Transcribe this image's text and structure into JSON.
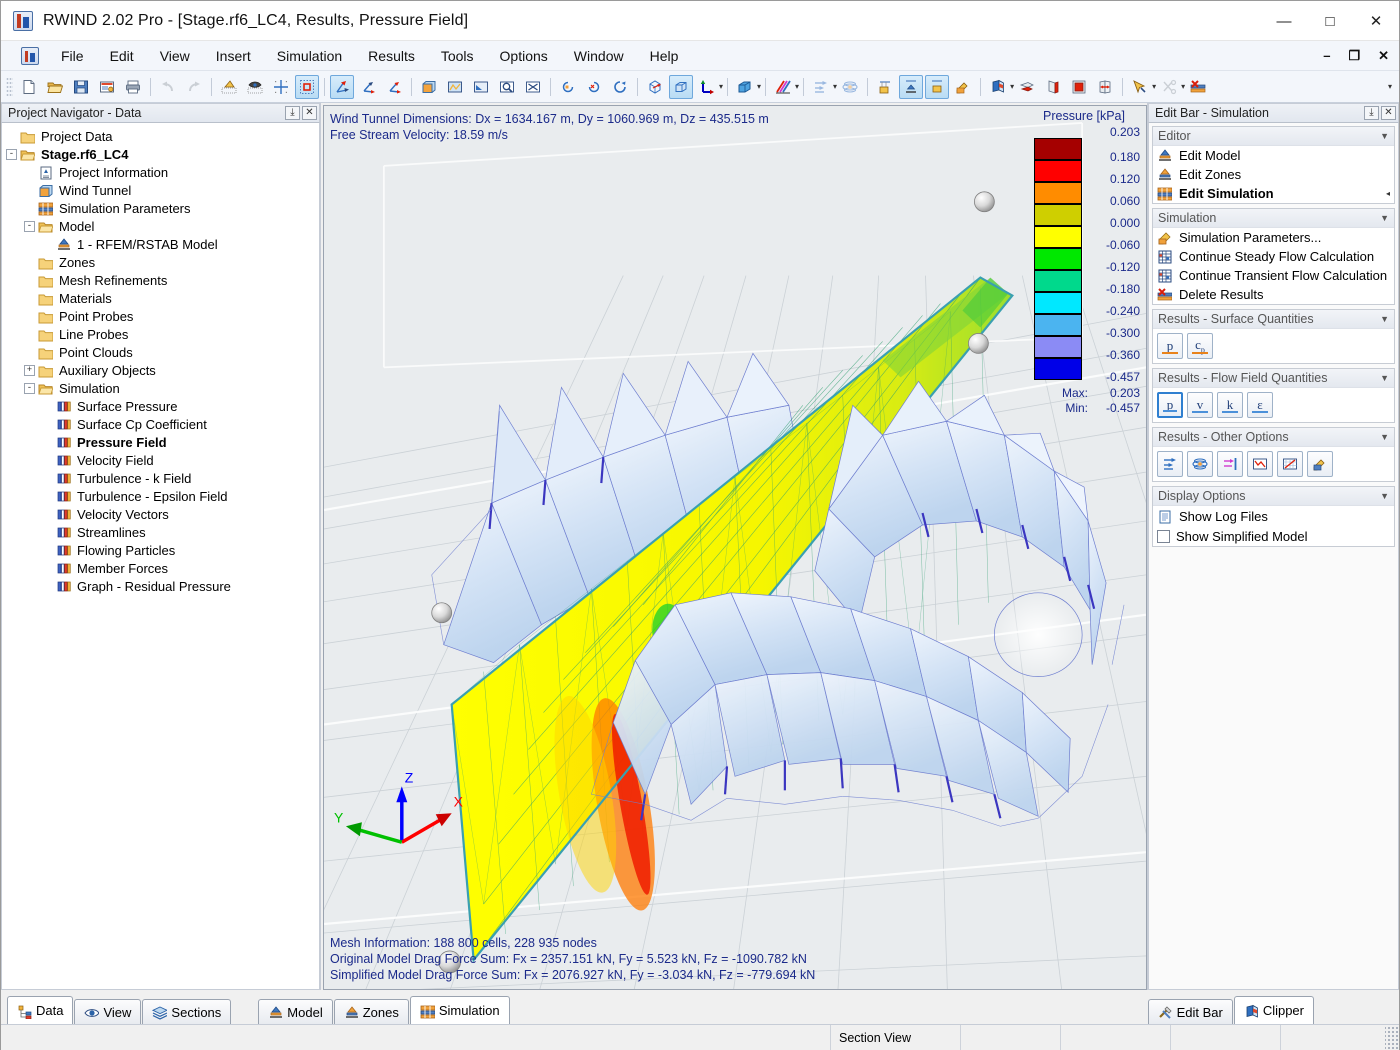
{
  "window": {
    "title": "RWIND 2.02 Pro - [Stage.rf6_LC4, Results, Pressure Field]",
    "minimize": "—",
    "maximize": "□",
    "close": "✕"
  },
  "mdi": {
    "minimize": "–",
    "restore": "❐",
    "close": "✕"
  },
  "menubar": {
    "items": [
      {
        "label": "File"
      },
      {
        "label": "Edit"
      },
      {
        "label": "View"
      },
      {
        "label": "Insert"
      },
      {
        "label": "Simulation"
      },
      {
        "label": "Results"
      },
      {
        "label": "Tools"
      },
      {
        "label": "Options"
      },
      {
        "label": "Window"
      },
      {
        "label": "Help"
      }
    ]
  },
  "toolbar": {
    "groups": [
      {
        "buttons": [
          {
            "icon": "new-document-icon",
            "state": "normal"
          },
          {
            "icon": "open-folder-icon",
            "state": "normal"
          },
          {
            "icon": "save-disk-icon",
            "state": "normal"
          },
          {
            "icon": "project-info-icon",
            "state": "normal"
          },
          {
            "icon": "print-icon",
            "state": "normal"
          }
        ]
      },
      {
        "buttons": [
          {
            "icon": "undo-icon",
            "state": "disabled"
          },
          {
            "icon": "redo-icon",
            "state": "disabled"
          }
        ]
      },
      {
        "buttons": [
          {
            "icon": "snap-points-icon",
            "state": "normal"
          },
          {
            "icon": "object-snap-icon",
            "state": "normal"
          },
          {
            "icon": "grid-snap-icon",
            "state": "normal"
          },
          {
            "icon": "selection-frame-icon",
            "state": "active"
          }
        ]
      },
      {
        "buttons": [
          {
            "icon": "move-axes-icon",
            "state": "active"
          },
          {
            "icon": "rotate-axes-icon",
            "state": "normal"
          },
          {
            "icon": "scale-axes-icon",
            "state": "normal"
          }
        ]
      },
      {
        "buttons": [
          {
            "icon": "wind-tunnel-icon",
            "state": "normal"
          },
          {
            "icon": "mesh-surface-icon",
            "state": "normal"
          },
          {
            "icon": "zoom-window-icon",
            "state": "normal"
          },
          {
            "icon": "zoom-area-icon",
            "state": "normal"
          },
          {
            "icon": "zoom-all-icon",
            "state": "normal"
          }
        ]
      },
      {
        "buttons": [
          {
            "icon": "rotate-left-icon",
            "state": "normal"
          },
          {
            "icon": "rotate-right-icon",
            "state": "normal"
          },
          {
            "icon": "rotate-view-icon",
            "state": "normal"
          }
        ]
      },
      {
        "buttons": [
          {
            "icon": "wireframe-cube-icon",
            "state": "normal"
          },
          {
            "icon": "solid-cube-icon",
            "state": "active"
          },
          {
            "icon": "axes-display-icon",
            "state": "normal",
            "dropdown": true
          }
        ]
      },
      {
        "buttons": [
          {
            "icon": "render-cube-icon",
            "state": "normal",
            "dropdown": true
          }
        ]
      },
      {
        "buttons": [
          {
            "icon": "color-scale-icon",
            "state": "normal",
            "dropdown": true
          }
        ]
      },
      {
        "buttons": [
          {
            "icon": "flow-arrows-icon",
            "state": "disabled",
            "dropdown": true
          },
          {
            "icon": "streamline-icon",
            "state": "disabled"
          }
        ]
      },
      {
        "buttons": [
          {
            "icon": "result-values-icon",
            "state": "normal"
          },
          {
            "icon": "model-results-icon",
            "state": "active"
          },
          {
            "icon": "surface-results-icon",
            "state": "active"
          },
          {
            "icon": "render-results-icon",
            "state": "normal"
          }
        ]
      },
      {
        "buttons": [
          {
            "icon": "clipper-box-icon",
            "state": "normal",
            "dropdown": true
          },
          {
            "icon": "section-plane-x-icon",
            "state": "normal"
          },
          {
            "icon": "section-plane-y-icon",
            "state": "normal"
          },
          {
            "icon": "section-plane-z-icon",
            "state": "normal"
          },
          {
            "icon": "section-move-icon",
            "state": "normal"
          }
        ]
      },
      {
        "buttons": [
          {
            "icon": "select-objects-icon",
            "state": "normal",
            "dropdown": true
          },
          {
            "icon": "cut-tool-icon",
            "state": "disabled",
            "dropdown": true
          },
          {
            "icon": "delete-results-icon",
            "state": "normal"
          }
        ]
      }
    ],
    "overflow": "▾"
  },
  "navigator": {
    "caption": "Project Navigator - Data",
    "pin": "⤓",
    "close": "✕",
    "tree": [
      {
        "label": "Project Data",
        "depth": 0,
        "expander": "",
        "icon": "folder-icon",
        "bold": false
      },
      {
        "label": "Stage.rf6_LC4",
        "depth": 0,
        "expander": "-",
        "icon": "folder-open-icon",
        "bold": true
      },
      {
        "label": "Project Information",
        "depth": 1,
        "expander": "",
        "icon": "document-info-icon",
        "bold": false
      },
      {
        "label": "Wind Tunnel",
        "depth": 1,
        "expander": "",
        "icon": "wind-tunnel-icon",
        "bold": false
      },
      {
        "label": "Simulation Parameters",
        "depth": 1,
        "expander": "",
        "icon": "simulation-params-icon",
        "bold": false
      },
      {
        "label": "Model",
        "depth": 1,
        "expander": "-",
        "icon": "folder-open-icon",
        "bold": false
      },
      {
        "label": "1 - RFEM/RSTAB Model",
        "depth": 2,
        "expander": "",
        "icon": "model-icon",
        "bold": false
      },
      {
        "label": "Zones",
        "depth": 1,
        "expander": "",
        "icon": "folder-icon",
        "bold": false
      },
      {
        "label": "Mesh Refinements",
        "depth": 1,
        "expander": "",
        "icon": "folder-icon",
        "bold": false
      },
      {
        "label": "Materials",
        "depth": 1,
        "expander": "",
        "icon": "folder-icon",
        "bold": false
      },
      {
        "label": "Point Probes",
        "depth": 1,
        "expander": "",
        "icon": "folder-icon",
        "bold": false
      },
      {
        "label": "Line Probes",
        "depth": 1,
        "expander": "",
        "icon": "folder-icon",
        "bold": false
      },
      {
        "label": "Point Clouds",
        "depth": 1,
        "expander": "",
        "icon": "folder-icon",
        "bold": false
      },
      {
        "label": "Auxiliary Objects",
        "depth": 1,
        "expander": "+",
        "icon": "folder-icon",
        "bold": false
      },
      {
        "label": "Simulation",
        "depth": 1,
        "expander": "-",
        "icon": "folder-open-icon",
        "bold": false
      },
      {
        "label": "Surface Pressure",
        "depth": 2,
        "expander": "",
        "icon": "results-bars-icon",
        "bold": false
      },
      {
        "label": "Surface Cp Coefficient",
        "depth": 2,
        "expander": "",
        "icon": "results-bars-icon",
        "bold": false
      },
      {
        "label": "Pressure Field",
        "depth": 2,
        "expander": "",
        "icon": "results-bars-icon",
        "bold": true
      },
      {
        "label": "Velocity Field",
        "depth": 2,
        "expander": "",
        "icon": "results-bars-icon",
        "bold": false
      },
      {
        "label": "Turbulence - k Field",
        "depth": 2,
        "expander": "",
        "icon": "results-bars-icon",
        "bold": false
      },
      {
        "label": "Turbulence - Epsilon Field",
        "depth": 2,
        "expander": "",
        "icon": "results-bars-icon",
        "bold": false
      },
      {
        "label": "Velocity Vectors",
        "depth": 2,
        "expander": "",
        "icon": "results-bars-icon",
        "bold": false
      },
      {
        "label": "Streamlines",
        "depth": 2,
        "expander": "",
        "icon": "results-bars-icon",
        "bold": false
      },
      {
        "label": "Flowing Particles",
        "depth": 2,
        "expander": "",
        "icon": "results-bars-icon",
        "bold": false
      },
      {
        "label": "Member Forces",
        "depth": 2,
        "expander": "",
        "icon": "results-bars-icon",
        "bold": false
      },
      {
        "label": "Graph - Residual Pressure",
        "depth": 2,
        "expander": "",
        "icon": "results-bars-icon",
        "bold": false
      }
    ]
  },
  "editbar": {
    "caption": "Edit Bar - Simulation",
    "pin": "⤓",
    "close": "✕",
    "groups": [
      {
        "title": "Editor",
        "type": "items",
        "items": [
          {
            "label": "Edit Model",
            "icon": "model-icon",
            "bold": false,
            "arrow": ""
          },
          {
            "label": "Edit Zones",
            "icon": "zones-icon",
            "bold": false,
            "arrow": ""
          },
          {
            "label": "Edit Simulation",
            "icon": "simulation-params-icon",
            "bold": true,
            "arrow": "◂"
          }
        ]
      },
      {
        "title": "Simulation",
        "type": "items",
        "items": [
          {
            "label": "Simulation Parameters...",
            "icon": "sim-settings-icon",
            "bold": false,
            "arrow": ""
          },
          {
            "label": "Continue Steady Flow Calculation",
            "icon": "calc-table-icon",
            "bold": false,
            "arrow": ""
          },
          {
            "label": "Continue Transient Flow Calculation",
            "icon": "calc-table-icon",
            "bold": false,
            "arrow": ""
          },
          {
            "label": "Delete Results",
            "icon": "delete-results-icon",
            "bold": false,
            "arrow": ""
          }
        ]
      },
      {
        "title": "Results - Surface Quantities",
        "type": "quantity-buttons",
        "buttons": [
          {
            "label": "p",
            "sub": "",
            "selected": false,
            "accent": "#e8821a"
          },
          {
            "label": "c",
            "sub": "p",
            "selected": false,
            "accent": "#e8821a"
          }
        ]
      },
      {
        "title": "Results - Flow Field Quantities",
        "type": "quantity-buttons",
        "buttons": [
          {
            "label": "p",
            "sub": "",
            "selected": true,
            "accent": "#4a90d9"
          },
          {
            "label": "v",
            "sub": "",
            "selected": false,
            "accent": "#4a90d9"
          },
          {
            "label": "k",
            "sub": "",
            "selected": false,
            "accent": "#4a90d9"
          },
          {
            "label": "ε",
            "sub": "",
            "selected": false,
            "accent": "#4a90d9"
          }
        ]
      },
      {
        "title": "Results - Other Options",
        "type": "icon-buttons",
        "buttons": [
          {
            "icon": "flow-arrows-icon"
          },
          {
            "icon": "isosurface-icon"
          },
          {
            "icon": "section-line-icon"
          },
          {
            "icon": "residual-graph-icon"
          },
          {
            "icon": "chart-diagram-icon"
          },
          {
            "icon": "render-options-icon"
          }
        ]
      },
      {
        "title": "Display Options",
        "type": "checks",
        "items": [
          {
            "label": "Show Log Files",
            "kind": "doc",
            "checked": false
          },
          {
            "label": "Show Simplified Model",
            "kind": "checkbox",
            "checked": false
          }
        ]
      }
    ]
  },
  "viewport": {
    "top_info": [
      "Wind Tunnel Dimensions: Dx = 1634.167 m, Dy = 1060.969 m, Dz = 435.515 m",
      "Free Stream Velocity: 18.59 m/s"
    ],
    "bottom_info": [
      "Mesh Information: 188 800 cells, 228 935 nodes",
      "Original Model Drag Force Sum: Fx = 2357.151 kN, Fy = 5.523 kN, Fz = -1090.782 kN",
      "Simplified Model Drag Force Sum: Fx = 2076.927 kN, Fy = -3.034 kN, Fz = -779.694 kN"
    ],
    "axes": {
      "x": "X",
      "y": "Y",
      "z": "Z",
      "x_color": "#ff0000",
      "y_color": "#00c000",
      "z_color": "#0000ff"
    }
  },
  "legend": {
    "title": "Pressure [kPa]",
    "values": [
      "0.203",
      "0.180",
      "0.120",
      "0.060",
      "0.000",
      "-0.060",
      "-0.120",
      "-0.180",
      "-0.240",
      "-0.300",
      "-0.360",
      "-0.457"
    ],
    "colors": [
      "#a50000",
      "#ff0000",
      "#ff8c00",
      "#cfcf00",
      "#ffff00",
      "#00e800",
      "#00d98c",
      "#00e8ff",
      "#4bb4f0",
      "#8b8bf5",
      "#0000e8"
    ],
    "max_label": "Max:",
    "max_value": "0.203",
    "min_label": "Min:",
    "min_value": "-0.457"
  },
  "bottom_tabs": {
    "left": [
      {
        "label": "Data",
        "icon": "data-tree-icon",
        "active": true
      },
      {
        "label": "View",
        "icon": "eye-icon",
        "active": false
      },
      {
        "label": "Sections",
        "icon": "layers-icon",
        "active": false
      }
    ],
    "center": [
      {
        "label": "Model",
        "icon": "model-icon",
        "active": false
      },
      {
        "label": "Zones",
        "icon": "zones-icon",
        "active": false
      },
      {
        "label": "Simulation",
        "icon": "simulation-params-icon",
        "active": true
      }
    ],
    "right": [
      {
        "label": "Edit Bar",
        "icon": "tools-icon",
        "active": false
      },
      {
        "label": "Clipper",
        "icon": "clipper-box-icon",
        "active": true
      }
    ]
  },
  "statusbar": {
    "cells": [
      "",
      "Section View",
      "",
      "",
      "",
      ""
    ]
  }
}
